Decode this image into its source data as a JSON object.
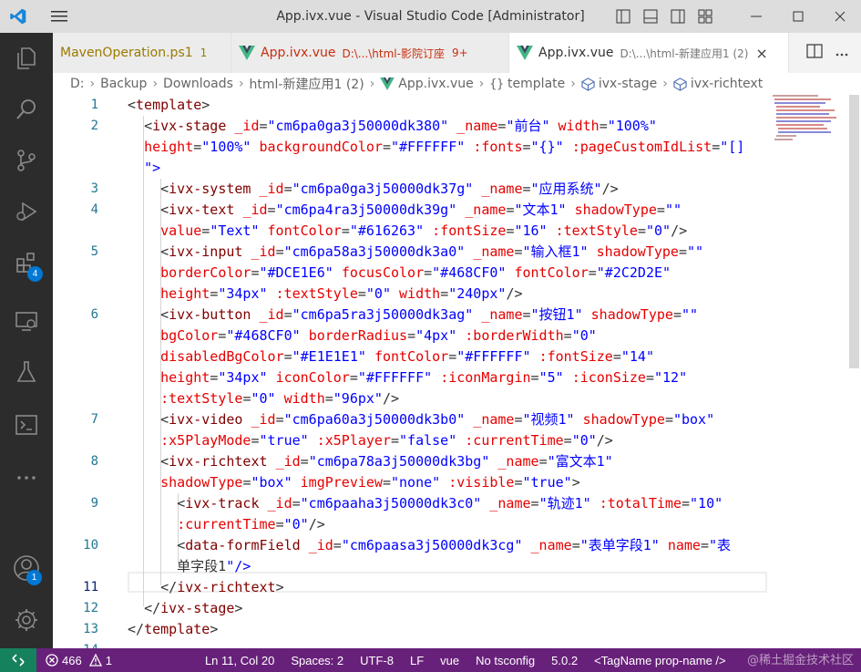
{
  "window": {
    "title": "App.ivx.vue - Visual Studio Code [Administrator]"
  },
  "activity_bar": {
    "extensions_badge": "4",
    "accounts_badge": "1"
  },
  "tabs": [
    {
      "label": "MavenOperation.ps1",
      "count": "1",
      "color": "#9a7a00"
    },
    {
      "label": "App.ivx.vue",
      "path": "D:\\...\\html-影院订座",
      "count": "9+",
      "color": "#c72e0f"
    },
    {
      "label": "App.ivx.vue",
      "path": "D:\\...\\html-新建应用1 (2)",
      "close": "×"
    }
  ],
  "breadcrumb": [
    "D:",
    "Backup",
    "Downloads",
    "html-新建应用1 (2)",
    "App.ivx.vue",
    "template",
    "ivx-stage",
    "ivx-richtext"
  ],
  "code": {
    "lines": [
      {
        "num": "1",
        "text": "<template>"
      },
      {
        "num": "2",
        "text": "  <ivx-stage _id=\"cm6pa0ga3j50000dk380\" _name=\"前台\" width=\"100%\" height=\"100%\" backgroundColor=\"#FFFFFF\" :fonts=\"{}\" :pageCustomIdList=\"[]\">"
      },
      {
        "num": "3",
        "text": "    <ivx-system _id=\"cm6pa0ga3j50000dk37g\" _name=\"应用系统\"/>"
      },
      {
        "num": "4",
        "text": "    <ivx-text _id=\"cm6pa4ra3j50000dk39g\" _name=\"文本1\" shadowType=\"\" value=\"Text\" fontColor=\"#616263\" :fontSize=\"16\" :textStyle=\"0\"/>"
      },
      {
        "num": "5",
        "text": "    <ivx-input _id=\"cm6pa58a3j50000dk3a0\" _name=\"输入框1\" shadowType=\"\" borderColor=\"#DCE1E6\" focusColor=\"#468CF0\" fontColor=\"#2C2D2E\" height=\"34px\" :textStyle=\"0\" width=\"240px\"/>"
      },
      {
        "num": "6",
        "text": "    <ivx-button _id=\"cm6pa5ra3j50000dk3ag\" _name=\"按钮1\" shadowType=\"\" bgColor=\"#468CF0\" borderRadius=\"4px\" :borderWidth=\"0\" disabledBgColor=\"#E1E1E1\" fontColor=\"#FFFFFF\" :fontSize=\"14\" height=\"34px\" iconColor=\"#FFFFFF\" :iconMargin=\"5\" :iconSize=\"12\" :textStyle=\"0\" width=\"96px\"/>"
      },
      {
        "num": "7",
        "text": "    <ivx-video _id=\"cm6pa60a3j50000dk3b0\" _name=\"视频1\" shadowType=\"box\" :x5PlayMode=\"true\" :x5Player=\"false\" :currentTime=\"0\"/>"
      },
      {
        "num": "8",
        "text": "    <ivx-richtext _id=\"cm6pa78a3j50000dk3bg\" _name=\"富文本1\" shadowType=\"box\" imgPreview=\"none\" :visible=\"true\">"
      },
      {
        "num": "9",
        "text": "      <ivx-track _id=\"cm6paaha3j50000dk3c0\" _name=\"轨迹1\" :totalTime=\"10\" :currentTime=\"0\"/>"
      },
      {
        "num": "10",
        "text": "      <data-formField _id=\"cm6paasa3j50000dk3cg\" _name=\"表单字段1\" name=\"表单字段1\"/>"
      },
      {
        "num": "11",
        "text": "    </ivx-richtext>"
      },
      {
        "num": "12",
        "text": "  </ivx-stage>"
      },
      {
        "num": "13",
        "text": "</template>"
      },
      {
        "num": "14",
        "text": ""
      }
    ],
    "current_line": "11"
  },
  "status_bar": {
    "errors": "466",
    "warnings": "1",
    "position": "Ln 11, Col 20",
    "spaces": "Spaces: 2",
    "encoding": "UTF-8",
    "eol": "LF",
    "language": "vue",
    "tsconfig": "No tsconfig",
    "version": "5.0.2",
    "tag_mode": "<TagName prop-name />",
    "watermark": "@稀土掘金技术社区"
  },
  "colors": {
    "activity_bar": "#2c2c2c",
    "status_bar": "#68217a",
    "remote": "#16825d",
    "tag": "#800000",
    "attribute": "#e50000",
    "string": "#0000ff",
    "vue_green": "#41b883"
  }
}
